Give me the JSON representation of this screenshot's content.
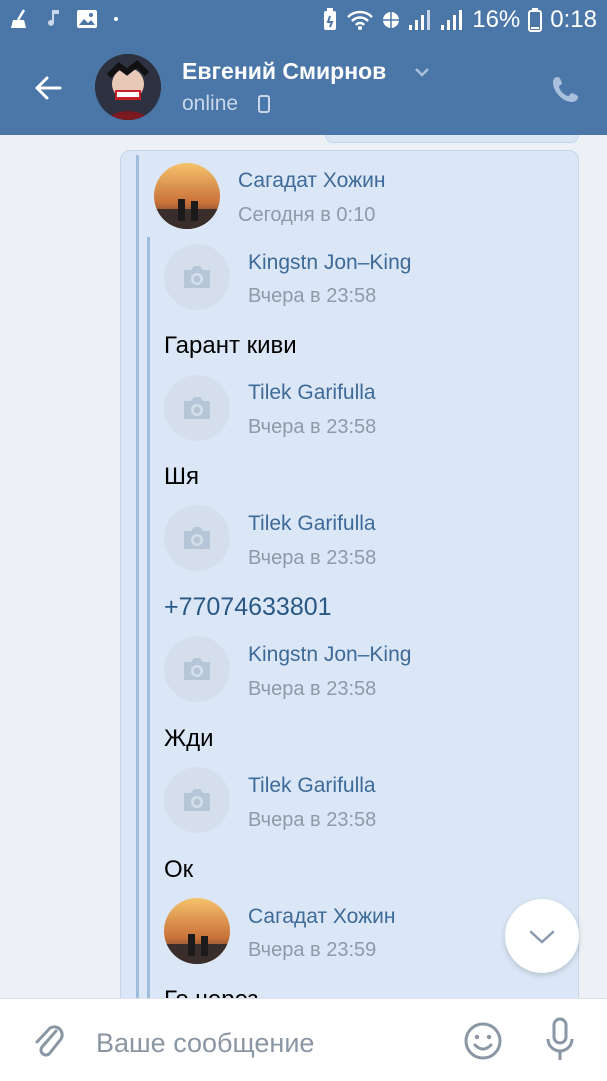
{
  "status_bar": {
    "battery_percent": "16%",
    "time": "0:18"
  },
  "header": {
    "contact_name": "Евгений Смирнов",
    "status": "online"
  },
  "forwarded": {
    "author_name": "Сагадат Хожин",
    "author_time": "Сегодня в 0:10",
    "messages": [
      {
        "name": "Kingstn Jon–King",
        "time": "Вчера в 23:58",
        "text": "Гарант киви"
      },
      {
        "name": "Tilek Garifulla",
        "time": "Вчера в 23:58",
        "text": "Шя"
      },
      {
        "name": "Tilek Garifulla",
        "time": "Вчера в 23:58",
        "text": "+77074633801"
      },
      {
        "name": "Kingstn Jon–King",
        "time": "Вчера в 23:58",
        "text": "Жди"
      },
      {
        "name": "Tilek Garifulla",
        "time": "Вчера в 23:58",
        "text": "Ок"
      },
      {
        "name": "Сагадат Хожин",
        "time": "Вчера в 23:59",
        "text": "Го через"
      }
    ]
  },
  "composer": {
    "placeholder": "Ваше сообщение"
  }
}
